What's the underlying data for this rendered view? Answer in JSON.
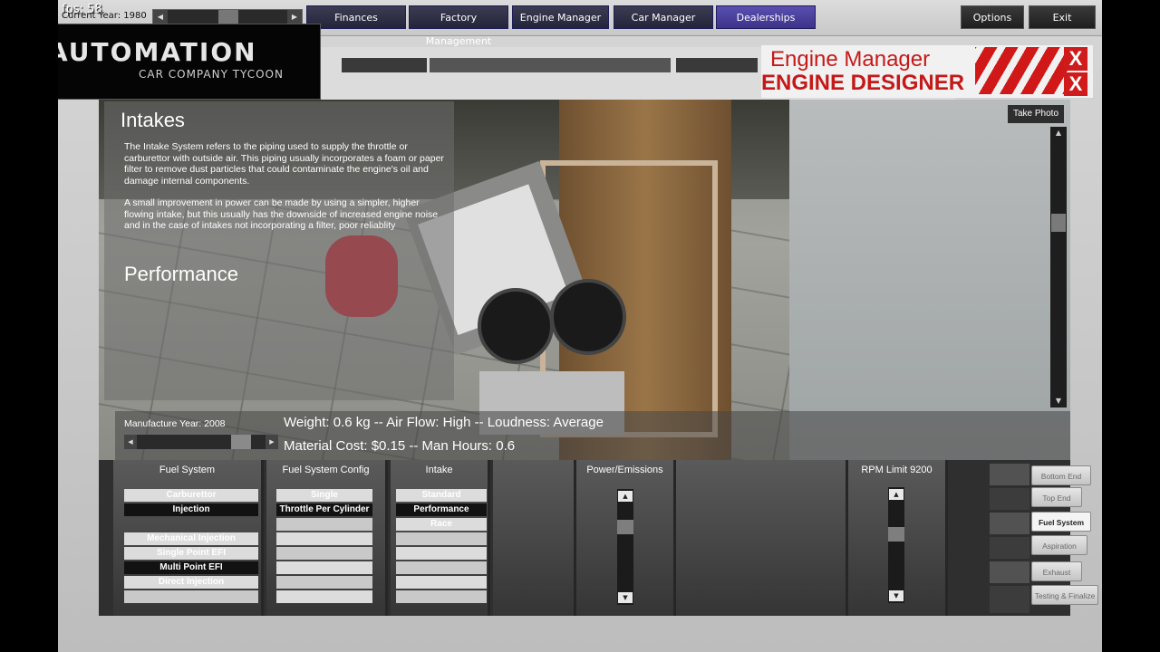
{
  "hud": {
    "fps": "fps: 58",
    "current_year": "Current Year: 1980"
  },
  "nav": {
    "finances": "Finances",
    "factory": "Factory Management",
    "engine": "Engine Manager",
    "car": "Car Manager",
    "dealerships": "Dealerships"
  },
  "menu": {
    "options": "Options",
    "exit": "Exit"
  },
  "logo": {
    "title": "AUTOMATION",
    "subtitle": "CAR COMPANY TYCOON"
  },
  "header": {
    "title1": "Engine Manager",
    "title2": "ENGINE DESIGNER",
    "close": "X"
  },
  "info": {
    "title": "Intakes",
    "p1": "The Intake System refers to the piping used to supply the throttle or carburettor with outside air. This piping usually incorporates a foam or paper filter to remove dust particles that could contaminate the engine's oil and damage internal components.",
    "p2": "A small improvement in power can be made by using a simpler, higher flowing intake, but this usually has the downside of increased engine noise and in the case of intakes not incorporating a filter, poor reliablity",
    "perf_title": "Performance"
  },
  "take_photo": "Take Photo",
  "stats": {
    "manufacture_year": "Manufacture Year: 2008",
    "line1": "Weight: 0.6 kg -- Air Flow: High -- Loudness: Average",
    "line2": "Material Cost: $0.15 -- Man Hours: 0.6"
  },
  "panels": {
    "fuel_system": {
      "title": "Fuel System",
      "options": [
        "Carburettor",
        "Injection"
      ],
      "sub": [
        "Mechanical Injection",
        "Single Point EFI",
        "Multi Point EFI",
        "Direct Injection"
      ]
    },
    "fuel_config": {
      "title": "Fuel System Config",
      "options": [
        "Single",
        "Throttle Per Cylinder"
      ]
    },
    "intake": {
      "title": "Intake",
      "options": [
        "Standard",
        "Performance",
        "Race"
      ]
    },
    "power": {
      "title": "Power/Emissions"
    },
    "rpm": {
      "title": "RPM Limit 9200"
    }
  },
  "tabs": [
    "Bottom End",
    "Top End",
    "Fuel System",
    "Aspiration",
    "Exhaust",
    "Testing & Finalize"
  ],
  "colors": {
    "accent_red": "#c41919",
    "nav_purple": "#4a40a0"
  }
}
